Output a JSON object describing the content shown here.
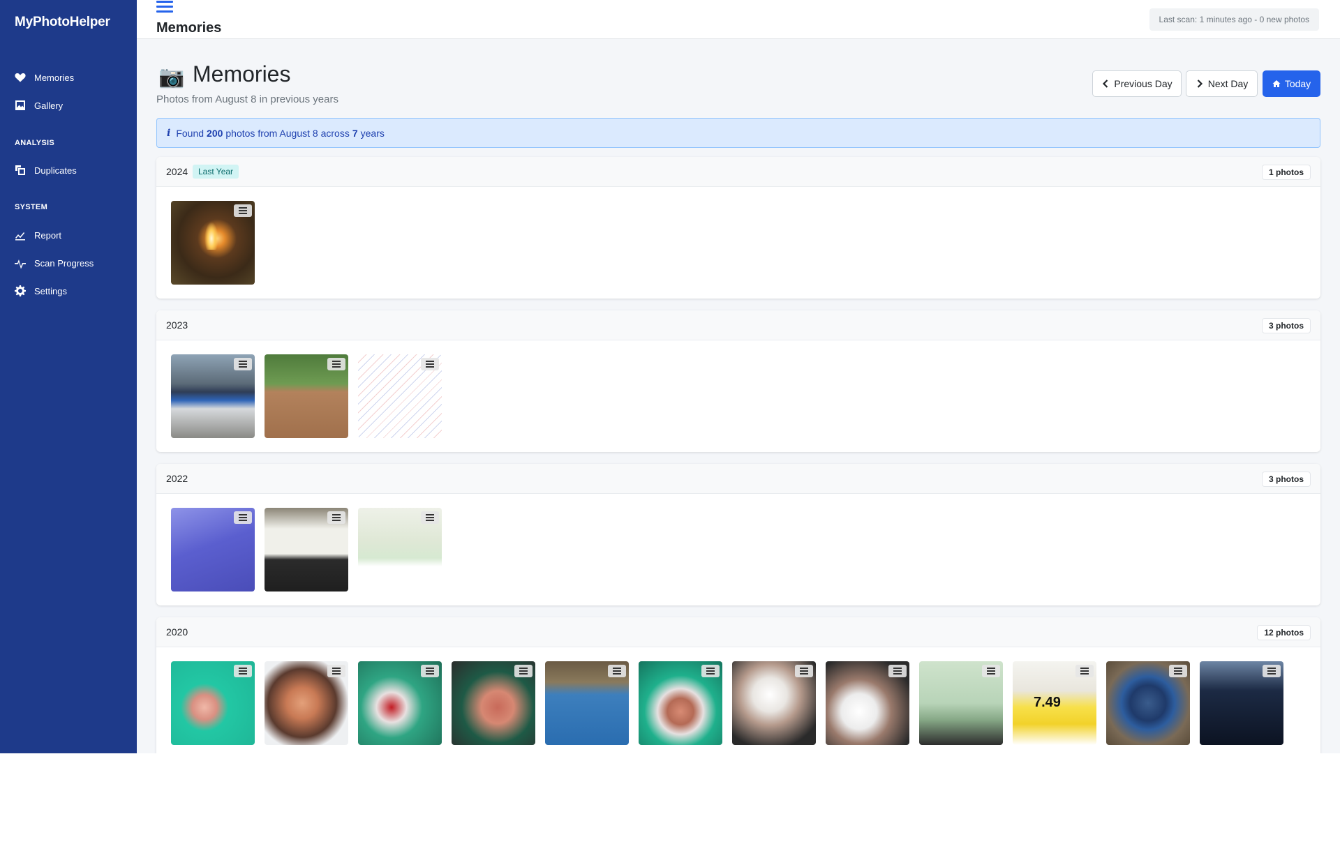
{
  "sidebar": {
    "brand": "MyPhotoHelper",
    "items": [
      {
        "label": "Memories"
      },
      {
        "label": "Gallery"
      }
    ],
    "sections": [
      {
        "heading": "ANALYSIS",
        "items": [
          {
            "label": "Duplicates"
          }
        ]
      },
      {
        "heading": "SYSTEM",
        "items": [
          {
            "label": "Report"
          },
          {
            "label": "Scan Progress"
          },
          {
            "label": "Settings"
          }
        ]
      }
    ]
  },
  "topbar": {
    "title": "Memories",
    "last_scan": "Last scan: 1 minutes ago - 0 new photos"
  },
  "header": {
    "title": "Memories",
    "subtitle": "Photos from August 8 in previous years",
    "icon": "camera-emoji"
  },
  "buttons": {
    "previous_day": "Previous Day",
    "next_day": "Next Day",
    "today": "Today"
  },
  "alert": {
    "prefix": "Found",
    "count": "200",
    "middle": "photos from August 8 across",
    "years": "7",
    "suffix": "years"
  },
  "years": [
    {
      "year": "2024",
      "badge": "Last Year",
      "count_label": "1 photos"
    },
    {
      "year": "2023",
      "count_label": "3 photos"
    },
    {
      "year": "2022",
      "count_label": "3 photos"
    },
    {
      "year": "2020",
      "count_label": "12 photos"
    }
  ],
  "thumbnails": {
    "price_tag_text": "7.49"
  },
  "colors": {
    "sidebar_bg": "#1e3a8a",
    "primary": "#2563eb",
    "alert_bg": "#dbeafe",
    "page_bg": "#f4f6f9"
  }
}
